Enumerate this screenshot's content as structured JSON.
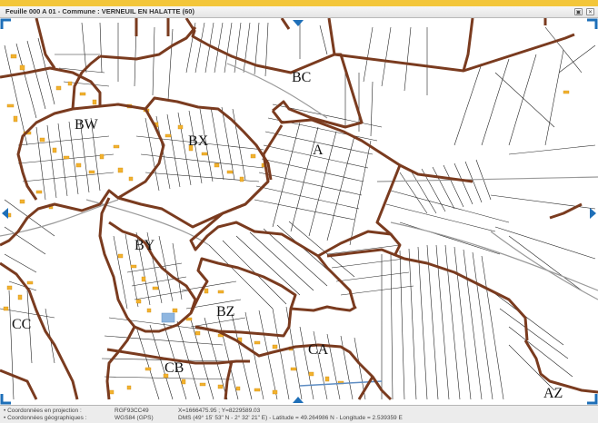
{
  "window": {
    "title": "Feuille 000 A 01 - Commune : VERNEUIL EN HALATTE (60)",
    "restore_icon": "restore-icon",
    "close_icon": "close-icon"
  },
  "map": {
    "sections": [
      "BC",
      "BW",
      "BX",
      "A",
      "BY",
      "CC",
      "BZ",
      "CA",
      "CB",
      "AZ"
    ],
    "boundary_color": "#7a3b1f",
    "parcel_line_color": "#222222",
    "building_color": "#f2b22e",
    "water_color": "#8fb6e0",
    "accent_color": "#1e6fb8",
    "nav_icons": [
      "pan-north-icon",
      "pan-west-icon",
      "pan-east-icon",
      "pan-south-icon"
    ]
  },
  "status": {
    "projection_label": "• Coordonnées en projection :",
    "projection_system": "RGF93CC49",
    "projection_value": "X=1666475.95 ; Y=8229589.03",
    "geo_label": "• Coordonnées géographiques :",
    "geo_system": "WGS84 (GPS)",
    "geo_value": "DMS (49° 15' 53\" N - 2° 32' 21\" E) - Latitude = 49.264986 N - Longitude = 2.539359 E"
  }
}
